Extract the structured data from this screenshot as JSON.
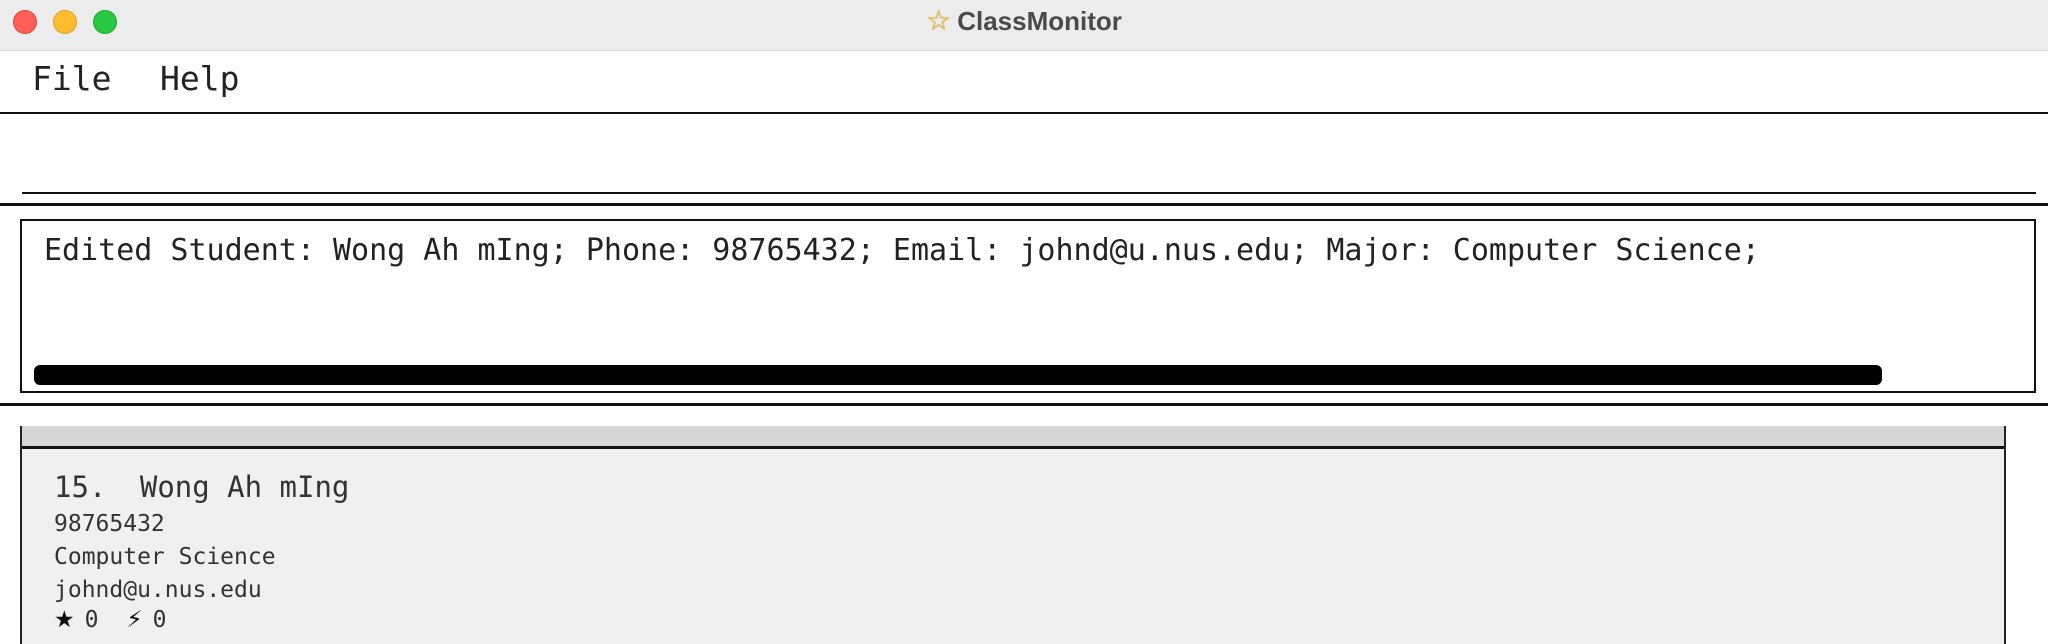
{
  "window": {
    "title": "ClassMonitor",
    "icon": "star-icon"
  },
  "menu": {
    "items": [
      {
        "label": "File"
      },
      {
        "label": "Help"
      }
    ]
  },
  "command": {
    "value": "",
    "placeholder": ""
  },
  "result": {
    "text": "Edited Student: Wong Ah mIng; Phone: 98765432; Email: johnd@u.nus.edu; Major: Computer Science;"
  },
  "students": [
    {
      "index": "15.",
      "name": "Wong Ah mIng",
      "phone": "98765432",
      "major": "Computer Science",
      "email": "johnd@u.nus.edu",
      "star_icon": "★",
      "stars": "0",
      "bolt_icon": "⚡",
      "bolts": "0"
    }
  ],
  "colors": {
    "close": "#ff5f57",
    "minimize": "#febc2e",
    "maximize": "#28c840",
    "list_bg": "#f0f0f0"
  }
}
